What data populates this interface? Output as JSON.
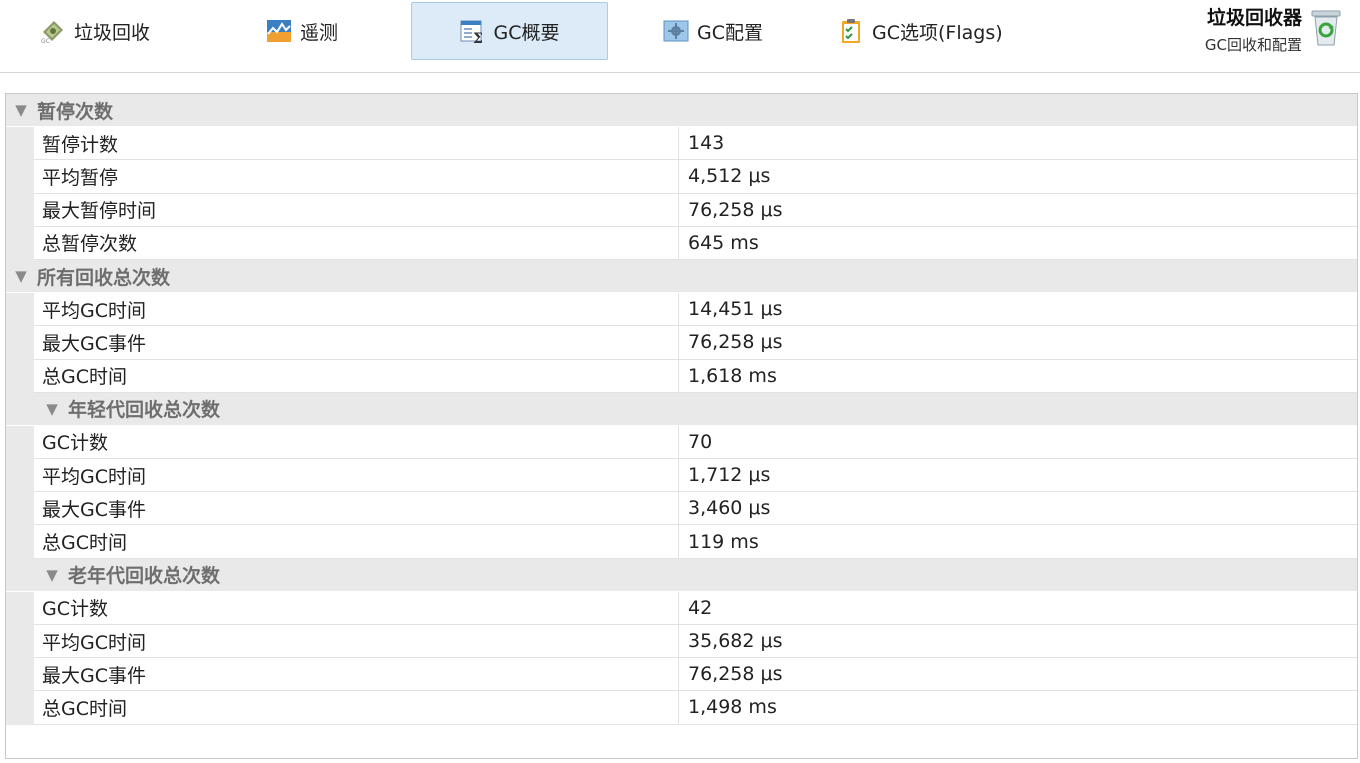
{
  "toolbar": {
    "tabs": [
      {
        "label": "垃圾回收",
        "icon": "gc-recycle-icon"
      },
      {
        "label": "遥测",
        "icon": "telemetry-chart-icon"
      },
      {
        "label": "GC概要",
        "icon": "summary-sigma-icon",
        "active": true
      },
      {
        "label": "GC配置",
        "icon": "config-gear-icon"
      },
      {
        "label": "GC选项(Flags)",
        "icon": "clipboard-check-icon"
      }
    ],
    "brand_title": "垃圾回收器",
    "brand_subtitle": "GC回收和配置",
    "brand_icon": "recycle-bin-icon"
  },
  "colors": {
    "active_tab_bg": "#dcebf7",
    "active_tab_border": "#a9cbe6",
    "group_row_bg": "#e9e9e9",
    "group_text": "#6e6e6e"
  },
  "groups": {
    "pause": {
      "label": "暂停次数",
      "rows": [
        {
          "name": "暂停计数",
          "value": "143"
        },
        {
          "name": "平均暂停",
          "value": "4,512 μs"
        },
        {
          "name": "最大暂停时间",
          "value": "76,258 μs"
        },
        {
          "name": "总暂停次数",
          "value": "645 ms"
        }
      ]
    },
    "all": {
      "label": "所有回收总次数",
      "rows": [
        {
          "name": "平均GC时间",
          "value": "14,451 μs"
        },
        {
          "name": "最大GC事件",
          "value": "76,258 μs"
        },
        {
          "name": "总GC时间",
          "value": "1,618 ms"
        }
      ]
    },
    "young": {
      "label": "年轻代回收总次数",
      "rows": [
        {
          "name": "GC计数",
          "value": "70"
        },
        {
          "name": "平均GC时间",
          "value": "1,712 μs"
        },
        {
          "name": "最大GC事件",
          "value": "3,460 μs"
        },
        {
          "name": "总GC时间",
          "value": "119 ms"
        }
      ]
    },
    "old": {
      "label": "老年代回收总次数",
      "rows": [
        {
          "name": "GC计数",
          "value": "42"
        },
        {
          "name": "平均GC时间",
          "value": "35,682 μs"
        },
        {
          "name": "最大GC事件",
          "value": "76,258 μs"
        },
        {
          "name": "总GC时间",
          "value": "1,498 ms"
        }
      ]
    }
  }
}
